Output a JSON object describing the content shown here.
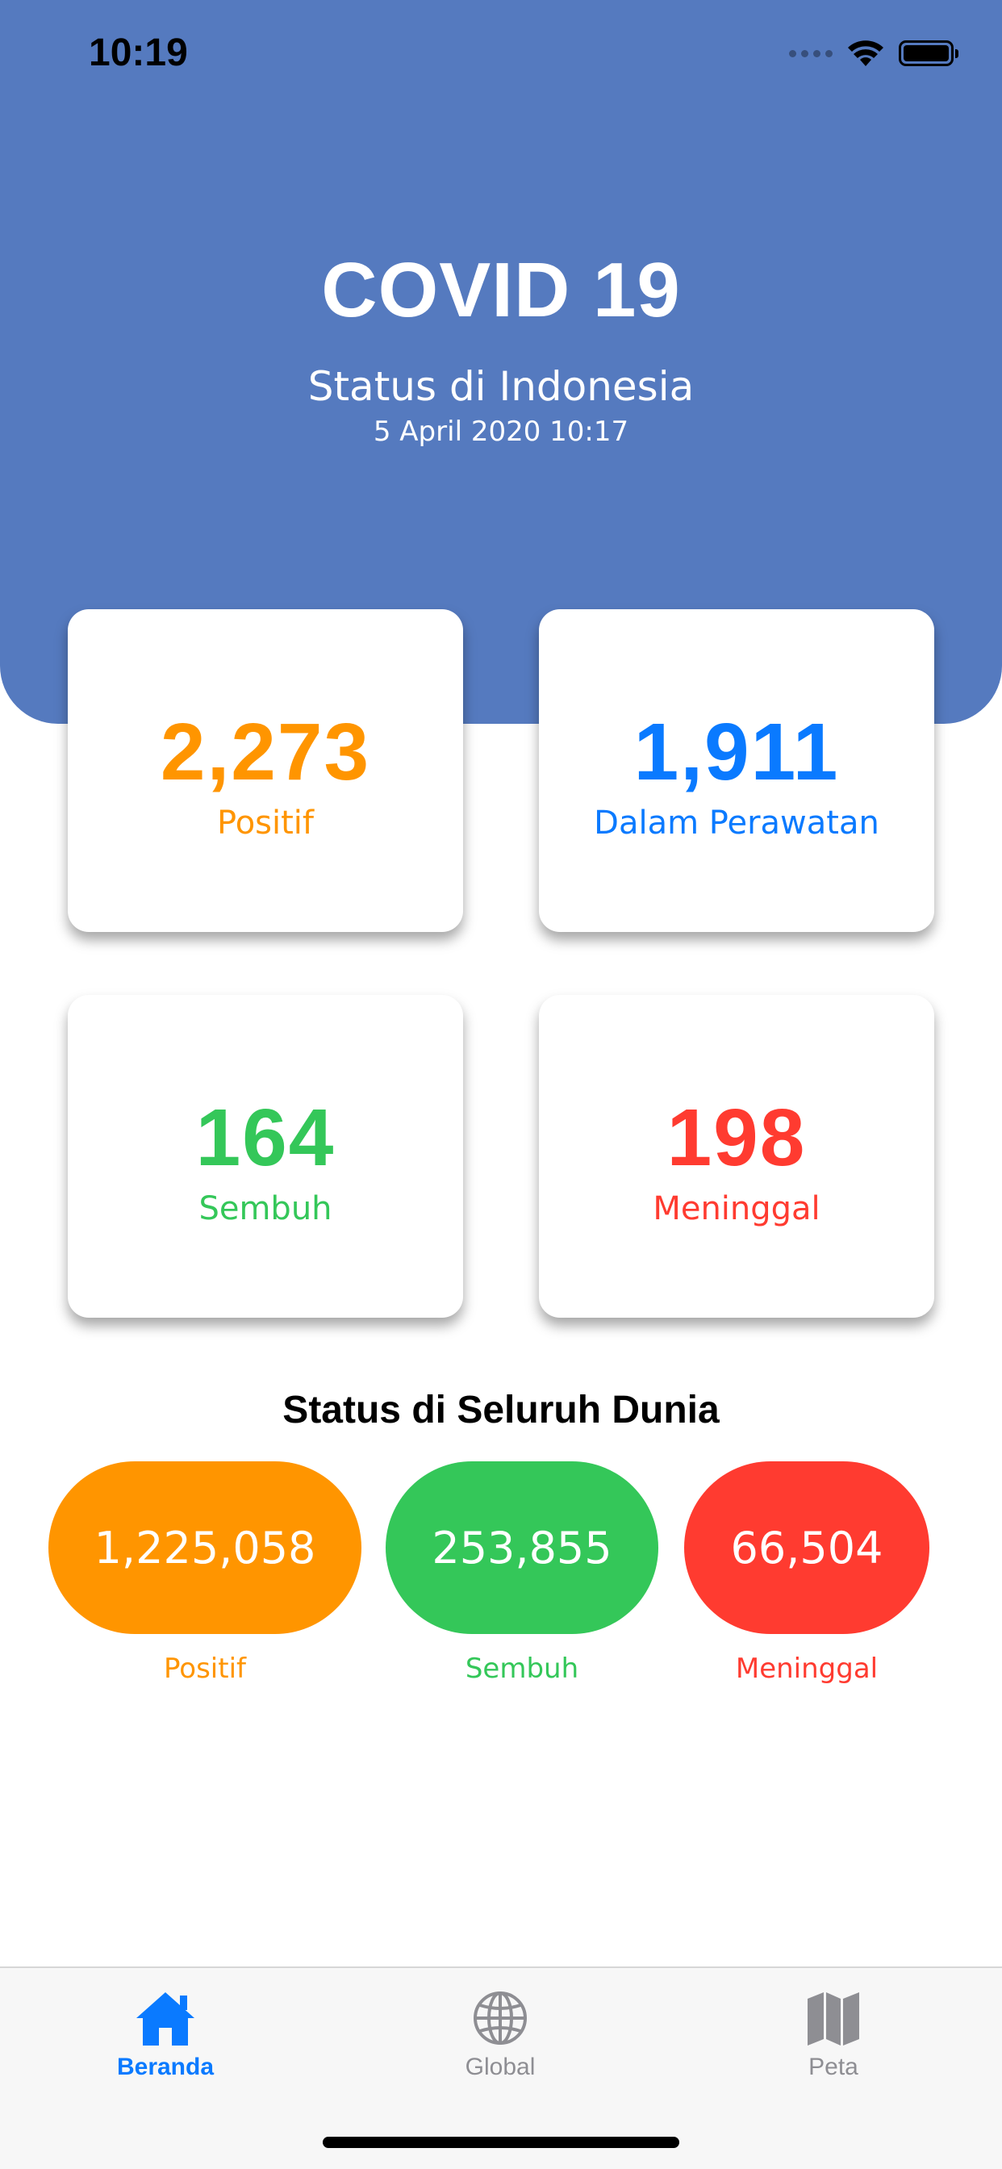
{
  "status_bar": {
    "time": "10:19"
  },
  "colors": {
    "header": "#557ABF",
    "orange": "#FF9500",
    "blue": "#0A7AFF",
    "green": "#34C759",
    "red": "#FF3B30",
    "tab_active": "#0A7AFF",
    "tab_inactive": "#8E8E93"
  },
  "header": {
    "title": "COVID 19",
    "subtitle": "Status di Indonesia",
    "date": "5 April 2020 10:17"
  },
  "indonesia": {
    "positive": {
      "value": "2,273",
      "label": "Positif"
    },
    "treated": {
      "value": "1,911",
      "label": "Dalam Perawatan"
    },
    "recovered": {
      "value": "164",
      "label": "Sembuh"
    },
    "deaths": {
      "value": "198",
      "label": "Meninggal"
    }
  },
  "world": {
    "title": "Status di Seluruh Dunia",
    "positive": {
      "value": "1,225,058",
      "label": "Positif"
    },
    "recovered": {
      "value": "253,855",
      "label": "Sembuh"
    },
    "deaths": {
      "value": "66,504",
      "label": "Meninggal"
    }
  },
  "tabbar": {
    "items": [
      {
        "label": "Beranda",
        "icon": "house-icon",
        "active": true
      },
      {
        "label": "Global",
        "icon": "globe-icon",
        "active": false
      },
      {
        "label": "Peta",
        "icon": "map-icon",
        "active": false
      }
    ]
  }
}
